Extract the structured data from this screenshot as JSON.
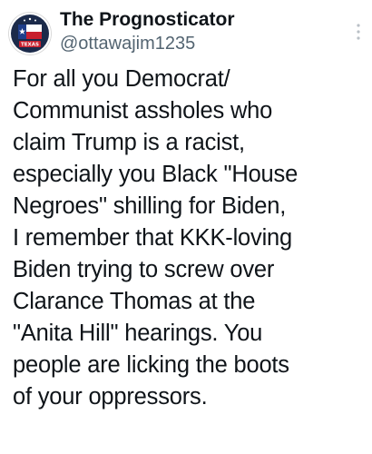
{
  "author": {
    "display_name": "The Prognosticator",
    "handle": "@ottawajim1235",
    "avatar_icon": "texas-flag-badge-icon",
    "avatar_text": "TEXAS"
  },
  "menu": {
    "icon": "more-vertical-icon"
  },
  "post": {
    "text": "For all you Democrat/\nCommunist assholes who\nclaim Trump is a racist,\nespecially you Black \"House\nNegroes\" shilling for Biden,\nI remember that KKK-loving\nBiden trying to screw over\nClarance Thomas at the\n\"Anita Hill\" hearings. You\npeople are licking the boots\nof your oppressors."
  },
  "colors": {
    "text": "#0f1419",
    "secondary_text": "#536471",
    "background": "#ffffff"
  }
}
